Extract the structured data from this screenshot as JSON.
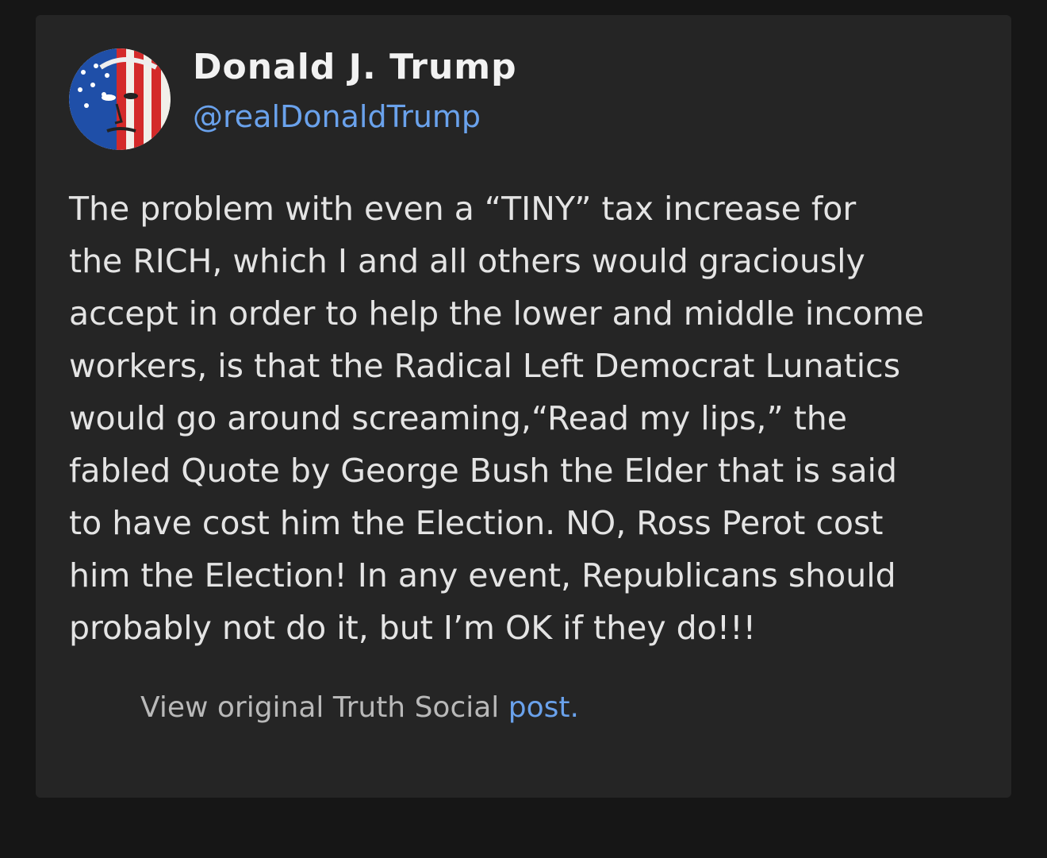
{
  "post": {
    "author": {
      "display_name": "Donald J. Trump",
      "handle": "@realDonaldTrump",
      "avatar_icon": "flag-painted-face-avatar"
    },
    "body_lines": [
      "The problem with even a “TINY” tax increase for",
      "the RICH, which I and all others would graciously",
      "accept in order to help the lower and middle income",
      "workers, is that the Radical Left Democrat Lunatics",
      "would go around screaming,“Read my lips,” the",
      "fabled Quote by George Bush the Elder that is said",
      "to have cost him the Election. NO, Ross Perot cost",
      "him the Election! In any event, Republicans should",
      "probably not do it, but I’m OK if they do!!!"
    ],
    "footer": {
      "prefix": "View original Truth Social ",
      "link_text": "post."
    }
  },
  "colors": {
    "page_background": "#161616",
    "card_background": "#252525",
    "accent_link": "#6aa2ec",
    "body_text": "#e4e4e4"
  }
}
